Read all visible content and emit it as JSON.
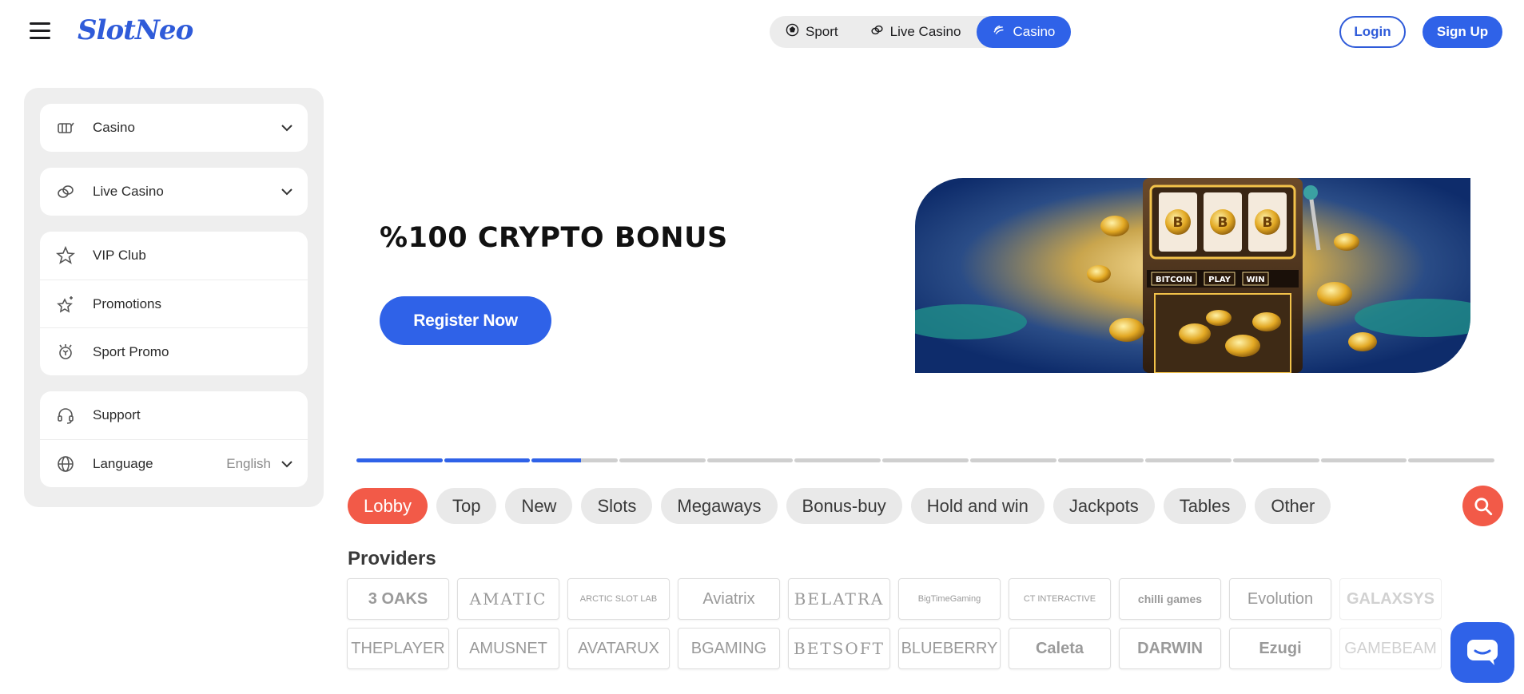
{
  "header": {
    "logo_text": "SlotNeo",
    "tabs": [
      {
        "label": "Sport",
        "icon": "soccer-ball-icon",
        "active": false
      },
      {
        "label": "Live Casino",
        "icon": "chips-icon",
        "active": false
      },
      {
        "label": "Casino",
        "icon": "casino-icon",
        "active": true
      }
    ],
    "login_label": "Login",
    "signup_label": "Sign Up"
  },
  "sidebar": {
    "groups": [
      [
        {
          "label": "Casino",
          "icon": "slot-machine-icon",
          "expandable": true
        }
      ],
      [
        {
          "label": "Live Casino",
          "icon": "chips-icon",
          "expandable": true
        }
      ],
      [
        {
          "label": "VIP Club",
          "icon": "vip-star-icon"
        },
        {
          "label": "Promotions",
          "icon": "sparkle-star-icon"
        },
        {
          "label": "Sport Promo",
          "icon": "sport-promo-icon"
        }
      ],
      [
        {
          "label": "Support",
          "icon": "headset-icon"
        },
        {
          "label": "Language",
          "icon": "globe-icon",
          "value": "English",
          "expandable": true
        }
      ]
    ]
  },
  "hero": {
    "title": "%100 CRYPTO BONUS",
    "cta_label": "Register Now",
    "image_labels": [
      "BITCOIN",
      "PLAY",
      "WIN"
    ]
  },
  "carousel": {
    "segments": 13,
    "progress": [
      1,
      1,
      0.57,
      0,
      0,
      0,
      0,
      0,
      0,
      0,
      0,
      0,
      0
    ]
  },
  "filters": {
    "chips": [
      "Lobby",
      "Top",
      "New",
      "Slots",
      "Megaways",
      "Bonus-buy",
      "Hold and win",
      "Jackpots",
      "Tables",
      "Other"
    ],
    "active": "Lobby"
  },
  "providers": {
    "title": "Providers",
    "row1": [
      "3 OAKS",
      "AMATIC",
      "ARCTIC SLOT LAB",
      "Aviatrix",
      "BELATRA",
      "BigTimeGaming",
      "CT INTERACTIVE",
      "chilli games",
      "Evolution",
      "GALAXSYS"
    ],
    "row2": [
      "THEPLAYER",
      "AMUSNET",
      "AVATARUX",
      "BGAMING",
      "BETSOFT",
      "BLUEBERRY",
      "Caleta",
      "DARWIN",
      "Ezugi",
      "GAMEBEAM"
    ]
  },
  "colors": {
    "brand_blue": "#2f62e8",
    "accent_coral": "#f25a48"
  }
}
